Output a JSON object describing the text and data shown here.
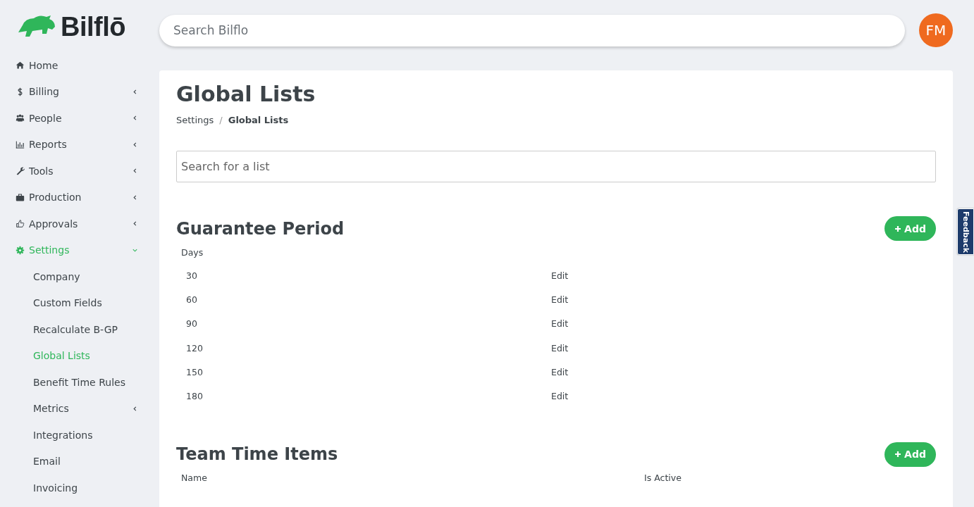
{
  "logo": {
    "text": "Bilflō"
  },
  "search": {
    "placeholder": "Search Bilflo"
  },
  "avatar": {
    "initials": "FM"
  },
  "sidebar": {
    "items": [
      {
        "label": "Home",
        "kind": "link",
        "selected": false
      },
      {
        "label": "Billing",
        "kind": "group",
        "expanded": false,
        "selected": false
      },
      {
        "label": "People",
        "kind": "group",
        "expanded": false,
        "selected": false
      },
      {
        "label": "Reports",
        "kind": "group",
        "expanded": false,
        "selected": false
      },
      {
        "label": "Tools",
        "kind": "group",
        "expanded": false,
        "selected": false
      },
      {
        "label": "Production",
        "kind": "group",
        "expanded": false,
        "selected": false
      },
      {
        "label": "Approvals",
        "kind": "group",
        "expanded": false,
        "selected": false
      },
      {
        "label": "Settings",
        "kind": "group",
        "expanded": true,
        "selected": true,
        "children": [
          {
            "label": "Company",
            "kind": "link",
            "selected": false
          },
          {
            "label": "Custom Fields",
            "kind": "link",
            "selected": false
          },
          {
            "label": "Recalculate B-GP",
            "kind": "link",
            "selected": false
          },
          {
            "label": "Global Lists",
            "kind": "link",
            "selected": true
          },
          {
            "label": "Benefit Time Rules",
            "kind": "link",
            "selected": false
          },
          {
            "label": "Metrics",
            "kind": "group",
            "expanded": false,
            "selected": false
          },
          {
            "label": "Integrations",
            "kind": "link",
            "selected": false
          },
          {
            "label": "Email",
            "kind": "link",
            "selected": false
          },
          {
            "label": "Invoicing",
            "kind": "link",
            "selected": false
          }
        ]
      }
    ]
  },
  "page": {
    "title": "Global Lists",
    "breadcrumb_separator": "/",
    "breadcrumb": [
      {
        "label": "Settings",
        "current": false
      },
      {
        "label": "Global Lists",
        "current": true
      }
    ],
    "list_search": {
      "placeholder": "Search for a list"
    },
    "sections": [
      {
        "title": "Guarantee Period",
        "add_button": "Add",
        "columns": [
          "Days"
        ],
        "rows": [
          {
            "cells": [
              "30"
            ],
            "action": "Edit"
          },
          {
            "cells": [
              "60"
            ],
            "action": "Edit"
          },
          {
            "cells": [
              "90"
            ],
            "action": "Edit"
          },
          {
            "cells": [
              "120"
            ],
            "action": "Edit"
          },
          {
            "cells": [
              "150"
            ],
            "action": "Edit"
          },
          {
            "cells": [
              "180"
            ],
            "action": "Edit"
          }
        ]
      },
      {
        "title": "Team Time Items",
        "add_button": "Add",
        "columns": [
          "Name",
          "Is Active"
        ]
      }
    ]
  },
  "feedback_tab": {
    "label": "Feedback"
  }
}
